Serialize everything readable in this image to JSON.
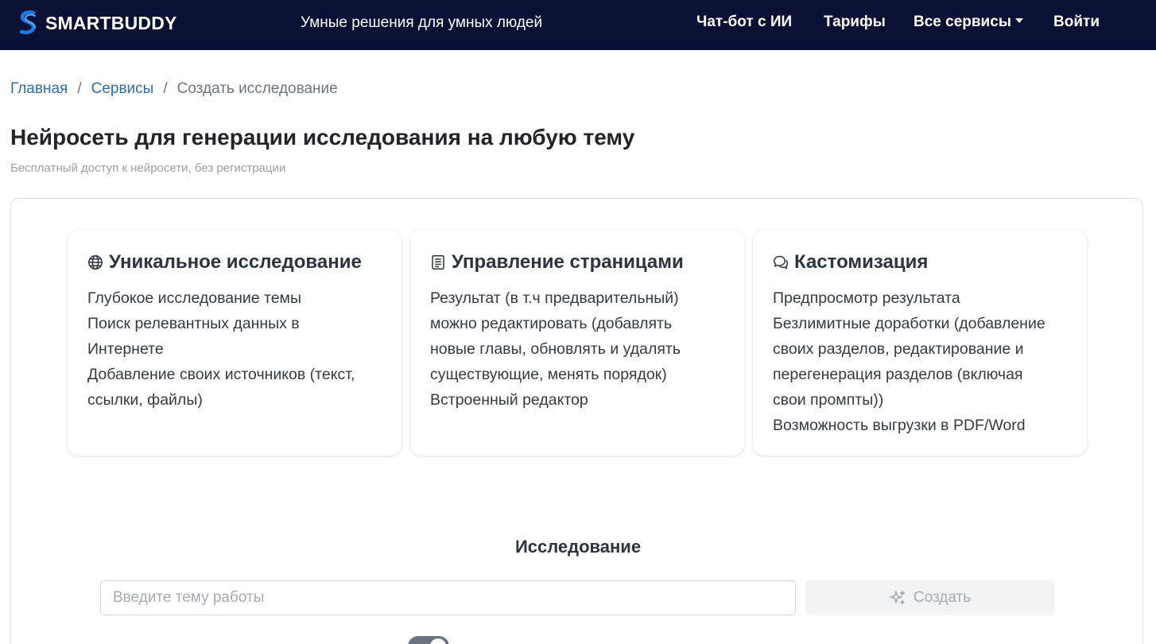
{
  "navbar": {
    "brand": "SMARTBUDDY",
    "tagline": "Умные решения для умных людей",
    "links": {
      "chat": "Чат-бот с ИИ",
      "tariffs": "Тарифы",
      "services": "Все сервисы",
      "login": "Войти"
    },
    "background": "#0b1135"
  },
  "breadcrumb": {
    "home": "Главная",
    "services": "Сервисы",
    "current": "Создать исследование",
    "separator": "/"
  },
  "page": {
    "title": "Нейросеть для генерации исследования на любую тему",
    "subtitle": "Бесплатный доступ к нейросети, без регистрации"
  },
  "features": [
    {
      "icon": "globe-icon",
      "title": "Уникальное исследование",
      "lines": [
        "Глубокое исследование темы",
        "Поиск релевантных данных в",
        "Интернете",
        "Добавление своих источников (текст,",
        "ссылки, файлы)"
      ]
    },
    {
      "icon": "document-icon",
      "title": "Управление страницами",
      "lines": [
        "Результат (в т.ч предварительный)",
        "можно редактировать (добавлять",
        "новые главы, обновлять и удалять",
        "существующие, менять порядок)",
        "Встроенный редактор"
      ]
    },
    {
      "icon": "chat-bubbles-icon",
      "title": "Кастомизация",
      "lines": [
        "Предпросмотр результата",
        "Безлимитные доработки (добавление",
        "своих разделов, редактирование и",
        "перегенерация разделов (включая",
        "свои промпты))",
        "Возможность выгрузки в PDF/Word"
      ]
    }
  ],
  "research": {
    "title": "Исследование",
    "input_placeholder": "Введите тему работы",
    "input_value": "",
    "create_label": "Создать",
    "toggle_label": "",
    "toggle_on": true
  },
  "colors": {
    "link": "#2f6fa8",
    "muted": "#6c757d"
  }
}
